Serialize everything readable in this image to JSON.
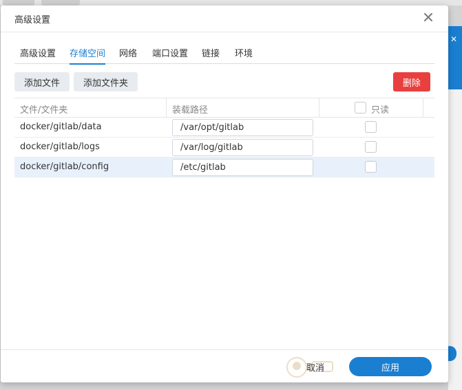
{
  "dialog": {
    "title": "高级设置",
    "close_icon": "close-icon"
  },
  "tabs": [
    {
      "label": "高级设置",
      "active": false
    },
    {
      "label": "存储空间",
      "active": true
    },
    {
      "label": "网络",
      "active": false
    },
    {
      "label": "端口设置",
      "active": false
    },
    {
      "label": "链接",
      "active": false
    },
    {
      "label": "环境",
      "active": false
    }
  ],
  "toolbar": {
    "add_file_label": "添加文件",
    "add_folder_label": "添加文件夹",
    "delete_label": "删除"
  },
  "table": {
    "headers": {
      "file_folder": "文件/文件夹",
      "mount_path": "装载路径",
      "read_only": "只读"
    },
    "rows": [
      {
        "name": "docker/gitlab/data",
        "path": "/var/opt/gitlab",
        "read_only": false,
        "selected": false
      },
      {
        "name": "docker/gitlab/logs",
        "path": "/var/log/gitlab",
        "read_only": false,
        "selected": false
      },
      {
        "name": "docker/gitlab/config",
        "path": "/etc/gitlab",
        "read_only": false,
        "selected": true
      }
    ]
  },
  "footer": {
    "cancel_label": "取消",
    "apply_label": "应用"
  },
  "colors": {
    "accent": "#1a7fd1",
    "danger": "#e8403f",
    "selected_row": "#e8f1fb"
  }
}
